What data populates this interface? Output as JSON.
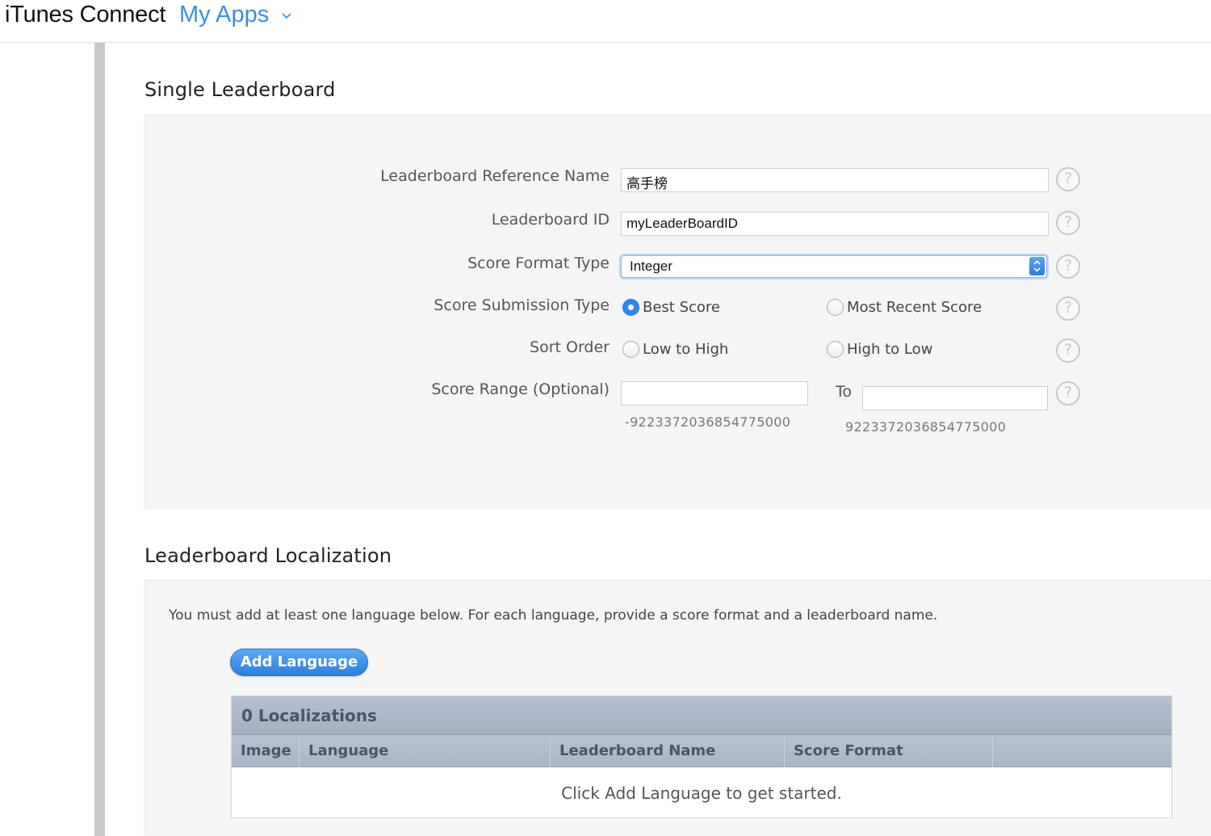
{
  "header": {
    "brand": "iTunes Connect",
    "nav_label": "My Apps"
  },
  "single": {
    "title": "Single Leaderboard",
    "ref_name_label": "Leaderboard Reference Name",
    "ref_name_value": "高手榜",
    "id_label": "Leaderboard ID",
    "id_value": "myLeaderBoardID",
    "format_label": "Score Format Type",
    "format_value": "Integer",
    "submission_label": "Score Submission Type",
    "submission_options": [
      "Best Score",
      "Most Recent Score"
    ],
    "submission_selected": "Best Score",
    "sort_label": "Sort Order",
    "sort_options": [
      "Low to High",
      "High to Low"
    ],
    "range_label": "Score Range (Optional)",
    "range_to": "To",
    "range_min_hint": "-9223372036854775000",
    "range_max_hint": "9223372036854775000",
    "help_glyph": "?"
  },
  "localization": {
    "title": "Leaderboard Localization",
    "description": "You must add at least one language below. For each language, provide a score format and a leaderboard name.",
    "add_button": "Add Language",
    "table_title": "0 Localizations",
    "columns": [
      "Image",
      "Language",
      "Leaderboard Name",
      "Score Format"
    ],
    "empty_text": "Click Add Language to get started."
  },
  "colors": {
    "accent": "#3a8fe0",
    "button_blue": "#2c7fdc",
    "panel_bg": "#f5f5f5",
    "table_header": "#a9b5c6"
  }
}
